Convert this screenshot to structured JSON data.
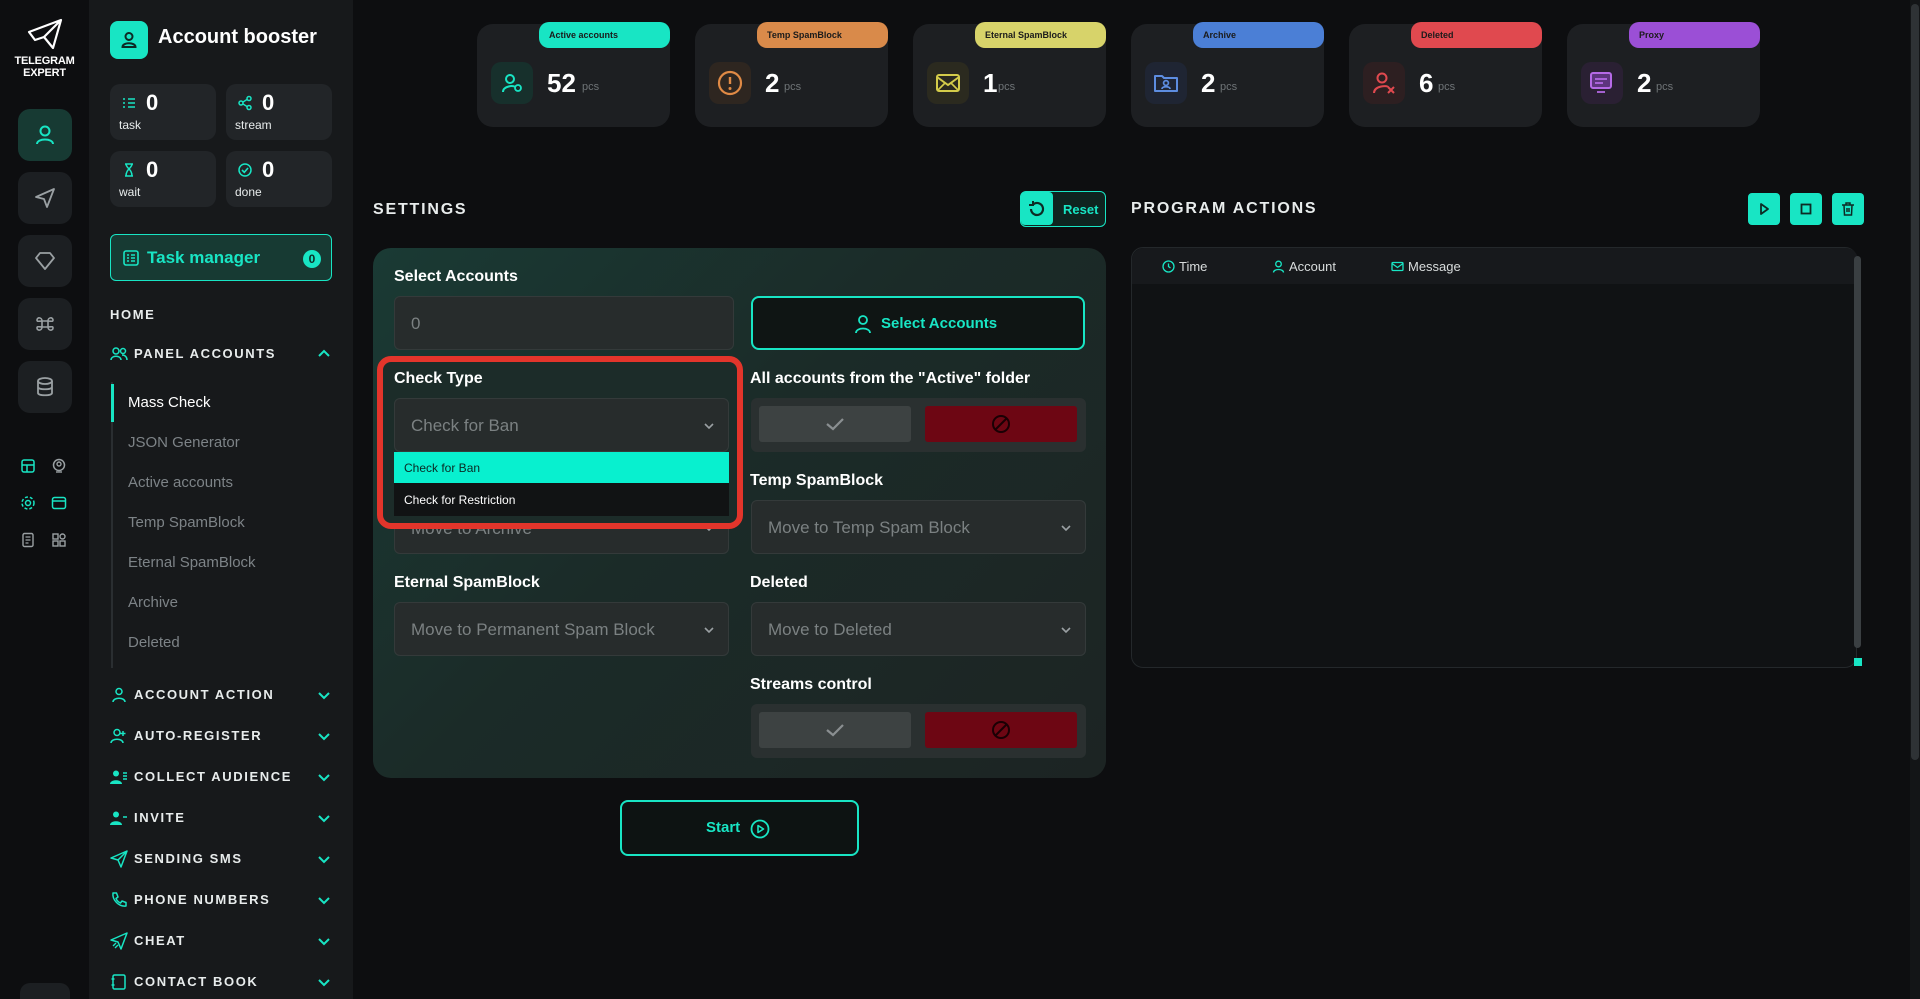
{
  "rail": {
    "logo_line1": "TELEGRAM",
    "logo_line2": "EXPERT",
    "buttons": [
      "user-icon",
      "send-icon",
      "diamond-icon",
      "command-icon",
      "database-icon"
    ]
  },
  "sidebar": {
    "brand": "Account booster",
    "stats": [
      {
        "value": "0",
        "label": "task"
      },
      {
        "value": "0",
        "label": "stream"
      },
      {
        "value": "0",
        "label": "wait"
      },
      {
        "value": "0",
        "label": "done"
      }
    ],
    "task_manager": {
      "label": "Task manager",
      "badge": "0"
    },
    "home": "HOME",
    "panel_accounts": "PANEL ACCOUNTS",
    "sub_items": [
      "Mass Check",
      "JSON Generator",
      "Active accounts",
      "Temp SpamBlock",
      "Eternal SpamBlock",
      "Archive",
      "Deleted"
    ],
    "sections": [
      "ACCOUNT ACTION",
      "AUTO-REGISTER",
      "COLLECT AUDIENCE",
      "INVITE",
      "SENDING SMS",
      "PHONE NUMBERS",
      "CHEAT",
      "CONTACT BOOK"
    ]
  },
  "cards": [
    {
      "pill": "Active accounts",
      "value": "52",
      "unit": "pcs",
      "color": "#18e5c4"
    },
    {
      "pill": "Temp SpamBlock",
      "value": "2",
      "unit": "pcs",
      "color": "#d98a4a"
    },
    {
      "pill": "Eternal SpamBlock",
      "value": "1",
      "unit": "pcs",
      "color": "#d7d36a"
    },
    {
      "pill": "Archive",
      "value": "2",
      "unit": "pcs",
      "color": "#4b7fd6"
    },
    {
      "pill": "Deleted",
      "value": "6",
      "unit": "pcs",
      "color": "#e0494f"
    },
    {
      "pill": "Proxy",
      "value": "2",
      "unit": "pcs",
      "color": "#9b4fd6"
    }
  ],
  "settings": {
    "title": "SETTINGS",
    "reset": "Reset",
    "select_accounts_label": "Select Accounts",
    "select_accounts_value": "0",
    "select_accounts_button": "Select Accounts",
    "check_type_label": "Check Type",
    "check_type_value": "Check for Ban",
    "check_type_options": [
      "Check for Ban",
      "Check for Restriction"
    ],
    "archive_value": "Move to Archive",
    "active_folder_label": "All accounts from the \"Active\" folder",
    "temp_spam_label": "Temp SpamBlock",
    "temp_spam_value": "Move to Temp Spam Block",
    "eternal_spam_label": "Eternal SpamBlock",
    "eternal_spam_value": "Move to Permanent Spam Block",
    "deleted_label": "Deleted",
    "deleted_value": "Move to Deleted",
    "streams_label": "Streams control",
    "start": "Start"
  },
  "program_actions": {
    "title": "PROGRAM ACTIONS",
    "columns": [
      "Time",
      "Account",
      "Message"
    ]
  },
  "colors": {
    "accent": "#18e5c4",
    "danger": "#6d0613",
    "highlight": "#e2352b"
  }
}
